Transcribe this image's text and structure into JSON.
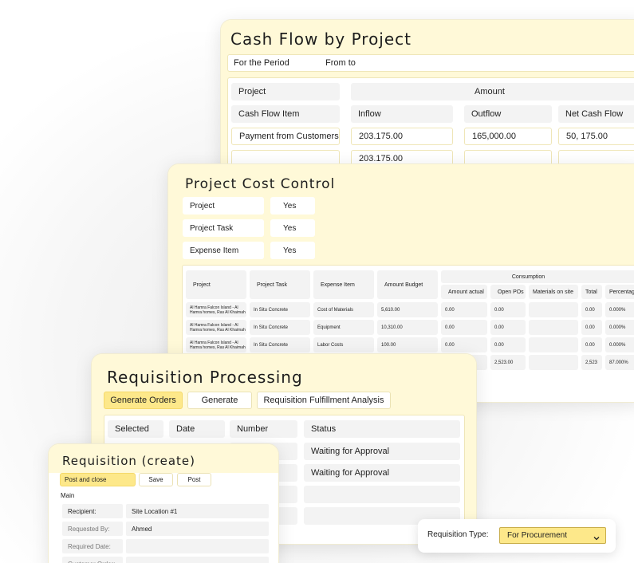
{
  "cash_flow": {
    "title": "Cash Flow by Project",
    "period_label": "For the Period",
    "from_to_label": "From to",
    "header_project": "Project",
    "header_amount": "Amount",
    "header_item": "Cash Flow Item",
    "header_inflow": "Inflow",
    "header_outflow": "Outflow",
    "header_net": "Net Cash Flow",
    "rows": [
      {
        "item": "Payment from Customers",
        "inflow": "203.175.00",
        "outflow": "165,000.00",
        "net": "50, 175.00"
      },
      {
        "item": "",
        "inflow": "203.175.00",
        "outflow": "",
        "net": ""
      }
    ]
  },
  "cost_control": {
    "title": "Project Cost Control",
    "filters": [
      {
        "label": "Project",
        "value": "Yes"
      },
      {
        "label": "Project Task",
        "value": "Yes"
      },
      {
        "label": "Expense Item",
        "value": "Yes"
      }
    ],
    "headers": {
      "project": "Project",
      "task": "Project Task",
      "expense": "Expense Item",
      "budget": "Amount Budget",
      "consumption": "Consumption",
      "actual": "Amount actual",
      "open_pos": "Open POs",
      "materials": "Materials on site",
      "total": "Total",
      "percentage": "Percentag"
    },
    "rows": [
      {
        "project": "Al Hamra Falcon Island - Al Hamra homes, Ras Al Khaimah",
        "task": "In Situ Concrete",
        "expense": "Cost of Materials",
        "budget": "5,610.00",
        "actual": "0.00",
        "open_pos": "0.00",
        "materials": "",
        "total": "0.00",
        "pct": "0.000%"
      },
      {
        "project": "Al Hamra Falcon Island - Al Hamra homes, Ras Al Khaimah",
        "task": "In Situ Concrete",
        "expense": "Equipment",
        "budget": "10,310.00",
        "actual": "0.00",
        "open_pos": "0.00",
        "materials": "",
        "total": "0.00",
        "pct": "0.000%"
      },
      {
        "project": "Al Hamra Falcon Island - Al Hamra homes, Ras Al Khaimah",
        "task": "In Situ Concrete",
        "expense": "Labor Costs",
        "budget": "100.00",
        "actual": "0.00",
        "open_pos": "0.00",
        "materials": "",
        "total": "0.00",
        "pct": "0.000%"
      },
      {
        "project": "",
        "task": "",
        "expense": "",
        "budget": "",
        "actual": "",
        "open_pos": "2,523.00",
        "materials": "",
        "total": "2,523",
        "pct": "87.000%"
      }
    ]
  },
  "requisition_processing": {
    "title": "Requisition Processing",
    "buttons": [
      "Generate Orders",
      "Generate",
      "Requisition Fulfillment Analysis"
    ],
    "headers": {
      "selected": "Selected",
      "date": "Date",
      "number": "Number",
      "status": "Status"
    },
    "statuses": [
      "Waiting for Approval",
      "Waiting for Approval",
      "",
      ""
    ]
  },
  "requisition_create": {
    "title": "Requisition (create)",
    "buttons": {
      "post_close": "Post and close",
      "save": "Save",
      "post": "Post"
    },
    "section": "Main",
    "fields": [
      {
        "label": "Recipient:",
        "value": "Site Location #1"
      },
      {
        "label": "Requested By:",
        "value": "Ahmed"
      },
      {
        "label": "Required Date:",
        "value": ""
      },
      {
        "label": "Customer Order:",
        "value": ""
      }
    ]
  },
  "requisition_type": {
    "label": "Requisition Type:",
    "value": "For Procurement"
  }
}
